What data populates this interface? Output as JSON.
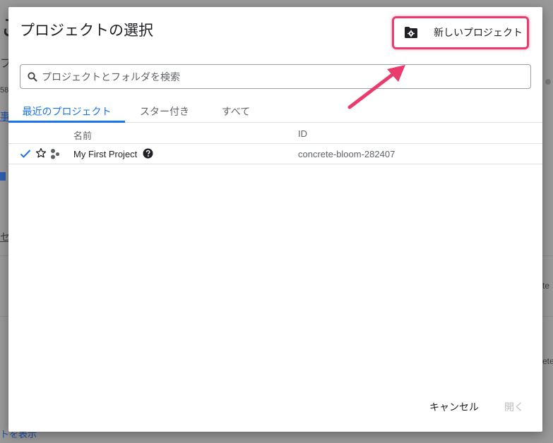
{
  "background": {
    "fragments": [
      "こ",
      "フ",
      "58",
      "事",
      "セ",
      "te",
      "ete",
      "トを表示"
    ]
  },
  "dialog": {
    "title": "プロジェクトの選択",
    "new_project_label": "新しいプロジェクト",
    "search_placeholder": "プロジェクトとフォルダを検索",
    "tabs": [
      "最近のプロジェクト",
      "スター付き",
      "すべて"
    ],
    "columns": {
      "name": "名前",
      "id": "ID"
    },
    "rows": [
      {
        "name": "My First Project",
        "id": "concrete-bloom-282407",
        "selected": true,
        "starred": false
      }
    ],
    "cancel_label": "キャンセル",
    "open_label": "開く"
  },
  "colors": {
    "accent": "#1a73e8",
    "highlight": "#ea3b6f",
    "disabled": "#bdbdbd"
  },
  "icons": [
    "folder-gear-icon",
    "search-icon",
    "check-icon",
    "star-outline-icon",
    "project-dots-icon",
    "help-icon",
    "annotation-arrow"
  ]
}
